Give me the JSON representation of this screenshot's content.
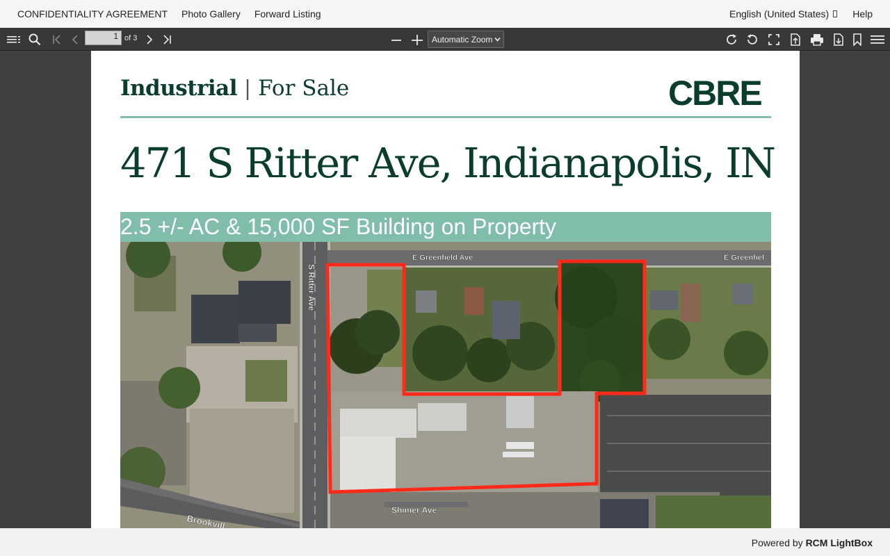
{
  "nav": {
    "left_links": [
      "CONFIDENTIALITY AGREEMENT",
      "Photo Gallery",
      "Forward Listing"
    ],
    "language": "English (United States)",
    "help": "Help"
  },
  "toolbar": {
    "page_number": "1",
    "page_count": "of 3",
    "zoom": "Automatic Zoom"
  },
  "document": {
    "category": "Industrial",
    "separator": "|",
    "status": "For Sale",
    "brand": "CBRE",
    "address": "471 S Ritter Ave, Indianapolis, IN",
    "banner": "2.5 +/- AC & 15,000 SF Building on Property",
    "map_labels": {
      "street_top": "E Greenfield Ave",
      "street_top_right": "E Greenfiel",
      "street_vertical": "S Ritter Ave",
      "street_bottom": "Shimer Ave",
      "street_bottom_left": "Brookvill"
    }
  },
  "footer": {
    "prefix": "Powered by",
    "brand": "RCM LightBox"
  },
  "colors": {
    "brand_green": "#0b3d2e",
    "accent_teal": "#80bdab",
    "boundary_red": "#ff2a1a",
    "toolbar": "#383838"
  }
}
